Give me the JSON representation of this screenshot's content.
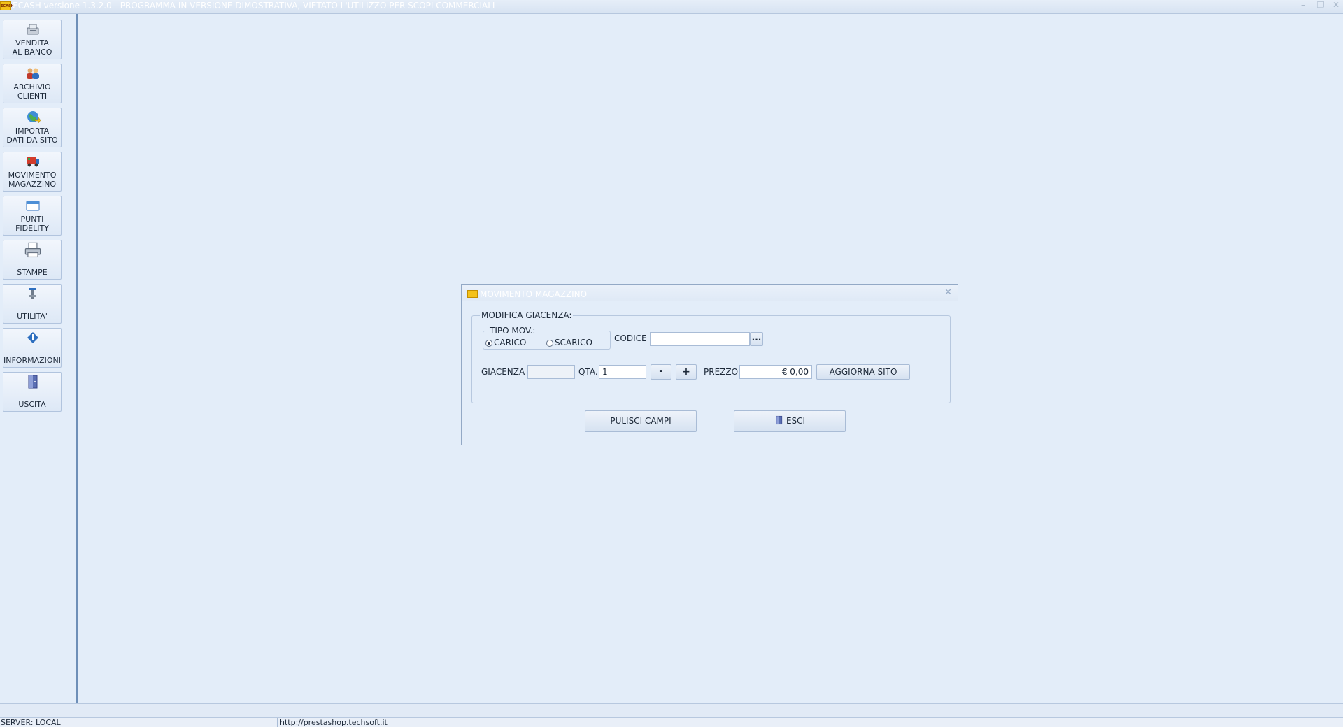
{
  "window": {
    "title": "ECASH versione 1.3.2.0 - PROGRAMMA IN VERSIONE DIMOSTRATIVA, VIETATO L'UTILIZZO PER SCOPI COMMERCIALI",
    "logo_text": "ECASH",
    "minimize_glyph": "–",
    "restore_glyph": "❐",
    "close_glyph": "✕"
  },
  "sidebar": {
    "items": [
      {
        "label": "VENDITA\nAL BANCO",
        "icon": "cash-register-icon"
      },
      {
        "label": "ARCHIVIO\nCLIENTI",
        "icon": "customers-icon"
      },
      {
        "label": "IMPORTA\nDATI DA SITO",
        "icon": "globe-import-icon"
      },
      {
        "label": "MOVIMENTO\nMAGAZZINO",
        "icon": "truck-icon"
      },
      {
        "label": "PUNTI\nFIDELITY",
        "icon": "card-icon"
      },
      {
        "label": "STAMPE",
        "icon": "printer-icon"
      },
      {
        "label": "UTILITA'",
        "icon": "tools-icon"
      },
      {
        "label": "INFORMAZIONI",
        "icon": "info-icon"
      },
      {
        "label": "USCITA",
        "icon": "exit-door-icon"
      }
    ]
  },
  "dialog": {
    "title": "MOVIMENTO MAGAZZINO",
    "close_glyph": "✕",
    "group_title": "MODIFICA GIACENZA:",
    "tipo_mov": {
      "title": "TIPO MOV.:",
      "options": [
        "CARICO",
        "SCARICO"
      ],
      "selected": "CARICO"
    },
    "codice": {
      "label": "CODICE",
      "value": "",
      "browse_label": "..."
    },
    "giacenza": {
      "label": "GIACENZA",
      "value": ""
    },
    "qta": {
      "label": "QTA.",
      "value": "1",
      "minus_label": "-",
      "plus_label": "+"
    },
    "prezzo": {
      "label": "PREZZO",
      "value": "€ 0,00"
    },
    "aggiorna_label": "AGGIORNA SITO",
    "pulisci_label": "PULISCI CAMPI",
    "esci_label": "ESCI"
  },
  "status": {
    "server": "SERVER: LOCAL",
    "url": "http://prestashop.techsoft.it"
  }
}
